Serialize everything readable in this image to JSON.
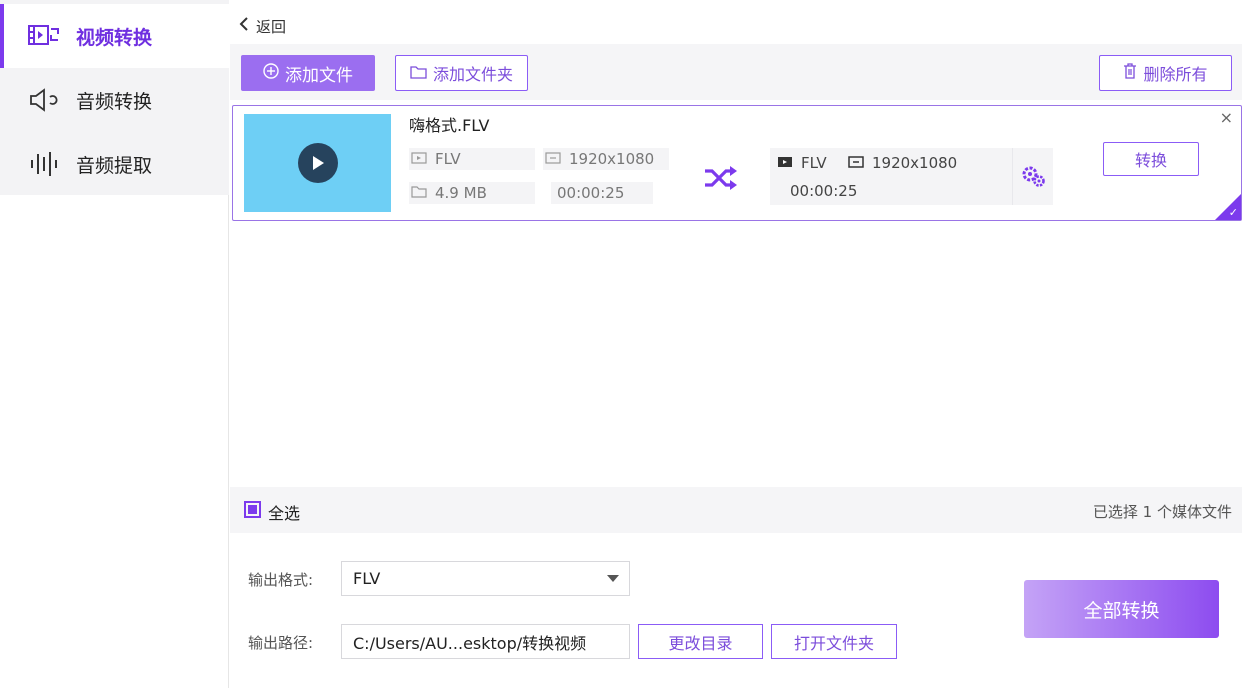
{
  "sidebar": {
    "items": [
      {
        "label": "视频转换",
        "icon": "video-convert-icon",
        "active": true
      },
      {
        "label": "音频转换",
        "icon": "speaker-icon",
        "active": false
      },
      {
        "label": "音频提取",
        "icon": "waveform-icon",
        "active": false
      }
    ]
  },
  "header": {
    "back_label": "返回"
  },
  "toolbar": {
    "add_file_label": "添加文件",
    "add_folder_label": "添加文件夹",
    "delete_all_label": "删除所有"
  },
  "file": {
    "name": "嗨格式.FLV",
    "source": {
      "format": "FLV",
      "resolution": "1920x1080",
      "size": "4.9 MB",
      "duration": "00:00:25"
    },
    "output": {
      "format": "FLV",
      "resolution": "1920x1080",
      "duration": "00:00:25"
    },
    "convert_label": "转换",
    "close_glyph": "×"
  },
  "select_bar": {
    "select_all_label": "全选",
    "selected_text": "已选择 1 个媒体文件"
  },
  "output": {
    "format_label": "输出格式:",
    "format_value": "FLV",
    "path_label": "输出路径:",
    "path_value": "C:/Users/AU...esktop/转换视频",
    "change_dir_label": "更改目录",
    "open_folder_label": "打开文件夹",
    "convert_all_label": "全部转换"
  },
  "colors": {
    "accent": "#7c3aed",
    "thumb": "#6ecff5",
    "button": "#9b6ef0"
  }
}
